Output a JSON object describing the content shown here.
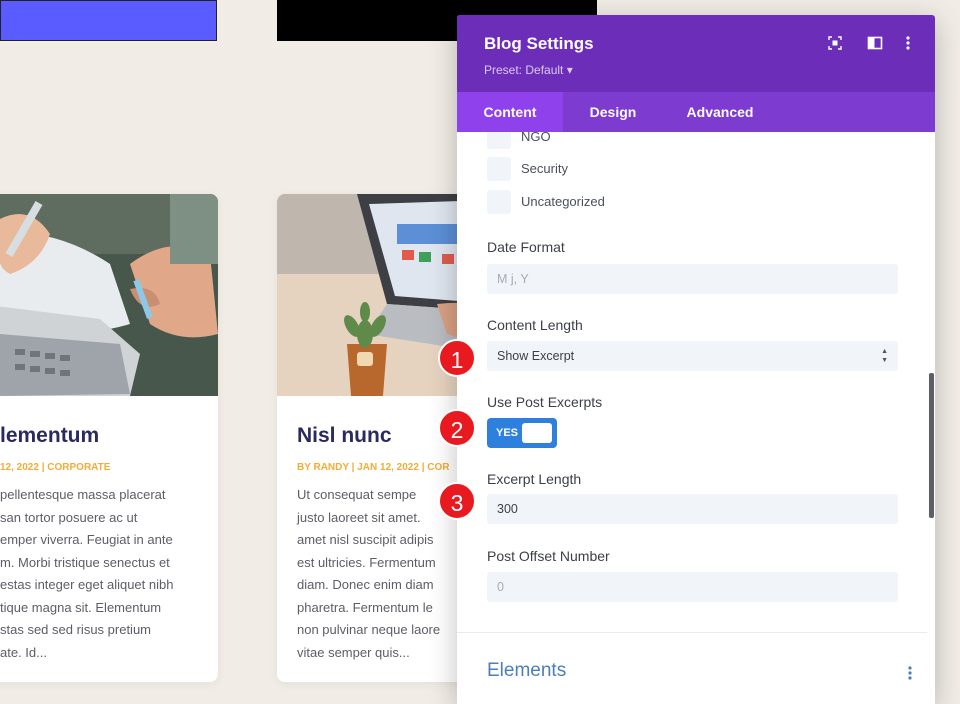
{
  "background": {
    "card1": {
      "title": "lementum",
      "meta": "12, 2022 | CORPORATE",
      "body": [
        "pellentesque massa placerat",
        "san tortor posuere ac ut",
        "emper viverra. Feugiat in ante",
        "m. Morbi tristique senectus et",
        "estas integer eget aliquet nibh",
        "tique magna sit. Elementum",
        "stas sed sed risus pretium",
        "ate. Id..."
      ]
    },
    "card2": {
      "title": "Nisl nunc",
      "meta": "BY RANDY | JAN 12, 2022 | COR",
      "body": [
        "Ut consequat sempe",
        "justo laoreet sit amet.",
        "amet nisl suscipit adipis",
        "est ultricies. Fermentum",
        "diam. Donec enim diam",
        "pharetra. Fermentum le",
        "non pulvinar neque laore",
        "vitae semper quis..."
      ]
    }
  },
  "panel": {
    "title": "Blog Settings",
    "preset": "Preset: Default ▾",
    "icons": [
      "focus-icon",
      "sidebar-icon",
      "more-vertical-icon"
    ],
    "tabs": [
      {
        "label": "Content",
        "active": true
      },
      {
        "label": "Design",
        "active": false
      },
      {
        "label": "Advanced",
        "active": false
      }
    ],
    "categories": [
      "NGO",
      "Security",
      "Uncategorized"
    ],
    "date_format": {
      "label": "Date Format",
      "placeholder": "M j, Y"
    },
    "content_length": {
      "label": "Content Length",
      "value": "Show Excerpt"
    },
    "use_post_excerpts": {
      "label": "Use Post Excerpts",
      "value": "YES"
    },
    "excerpt_length": {
      "label": "Excerpt Length",
      "value": "300"
    },
    "post_offset": {
      "label": "Post Offset Number",
      "placeholder": "0"
    },
    "elements_section": "Elements"
  },
  "annotations": [
    "1",
    "2",
    "3"
  ],
  "colors": {
    "header": "#6c2eb9",
    "tabs": "#7e3bd0",
    "active_tab": "#8f42ec",
    "toggle": "#2d80dc",
    "badge": "#e8191f"
  }
}
